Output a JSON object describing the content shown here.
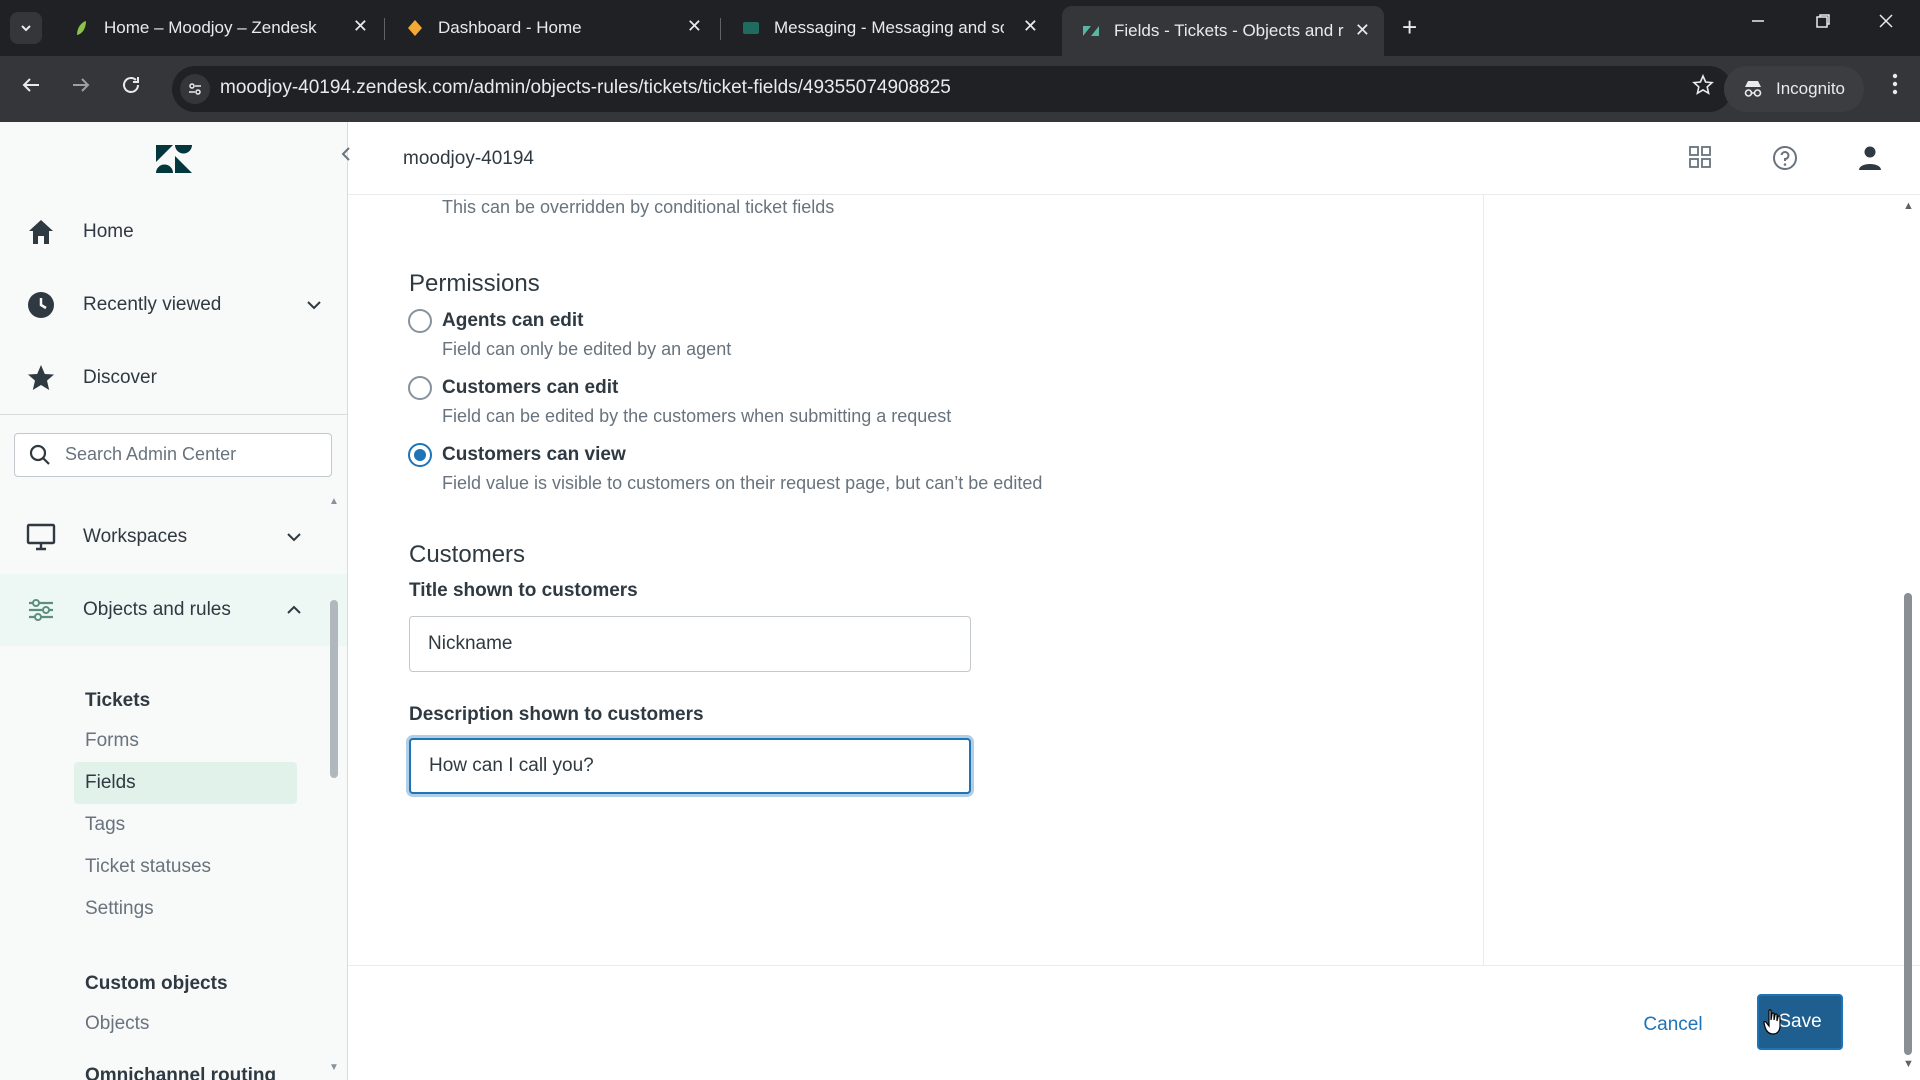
{
  "browser": {
    "tabs": [
      {
        "title": "Home – Moodjoy – Zendesk",
        "favicon": "zendesk-leaf-icon",
        "active": false
      },
      {
        "title": "Dashboard - Home",
        "favicon": "dashboard-icon",
        "active": false
      },
      {
        "title": "Messaging - Messaging and so",
        "favicon": "messaging-icon",
        "active": false
      },
      {
        "title": "Fields - Tickets - Objects and ru",
        "favicon": "zendesk-icon",
        "active": true
      }
    ],
    "url": "moodjoy-40194.zendesk.com/admin/objects-rules/tickets/ticket-fields/49355074908825",
    "incognito_label": "Incognito"
  },
  "header": {
    "account_name": "moodjoy-40194"
  },
  "sidebar": {
    "nav": [
      {
        "label": "Home",
        "icon": "home-icon"
      },
      {
        "label": "Recently viewed",
        "icon": "clock-icon"
      },
      {
        "label": "Discover",
        "icon": "star-icon"
      }
    ],
    "search_placeholder": "Search Admin Center",
    "sections": [
      {
        "label": "Workspaces",
        "icon": "monitor-icon"
      },
      {
        "label": "Objects and rules",
        "icon": "objects-rules-icon"
      }
    ],
    "tickets_group": "Tickets",
    "tickets_items": [
      "Forms",
      "Fields",
      "Tags",
      "Ticket statuses",
      "Settings"
    ],
    "custom_objects_group": "Custom objects",
    "custom_objects_items": [
      "Objects"
    ],
    "next_group": "Omnichannel routing"
  },
  "main": {
    "override_hint": "This can be overridden by conditional ticket fields",
    "permissions_title": "Permissions",
    "permissions": [
      {
        "label": "Agents can edit",
        "hint": "Field can only be edited by an agent",
        "checked": false
      },
      {
        "label": "Customers can edit",
        "hint": "Field can be edited by the customers when submitting a request",
        "checked": false
      },
      {
        "label": "Customers can view",
        "hint": "Field value is visible to customers on their request page, but can’t be edited",
        "checked": true
      }
    ],
    "customers_title": "Customers",
    "title_label": "Title shown to customers",
    "title_value": "Nickname",
    "description_label": "Description shown to customers",
    "description_value": "How can I call you?"
  },
  "footer": {
    "cancel_label": "Cancel",
    "save_label": "Save"
  },
  "colors": {
    "accent": "#1f73b7",
    "sidebar_bg": "#f8f9f9",
    "selected_bg": "#e1f2ea"
  }
}
